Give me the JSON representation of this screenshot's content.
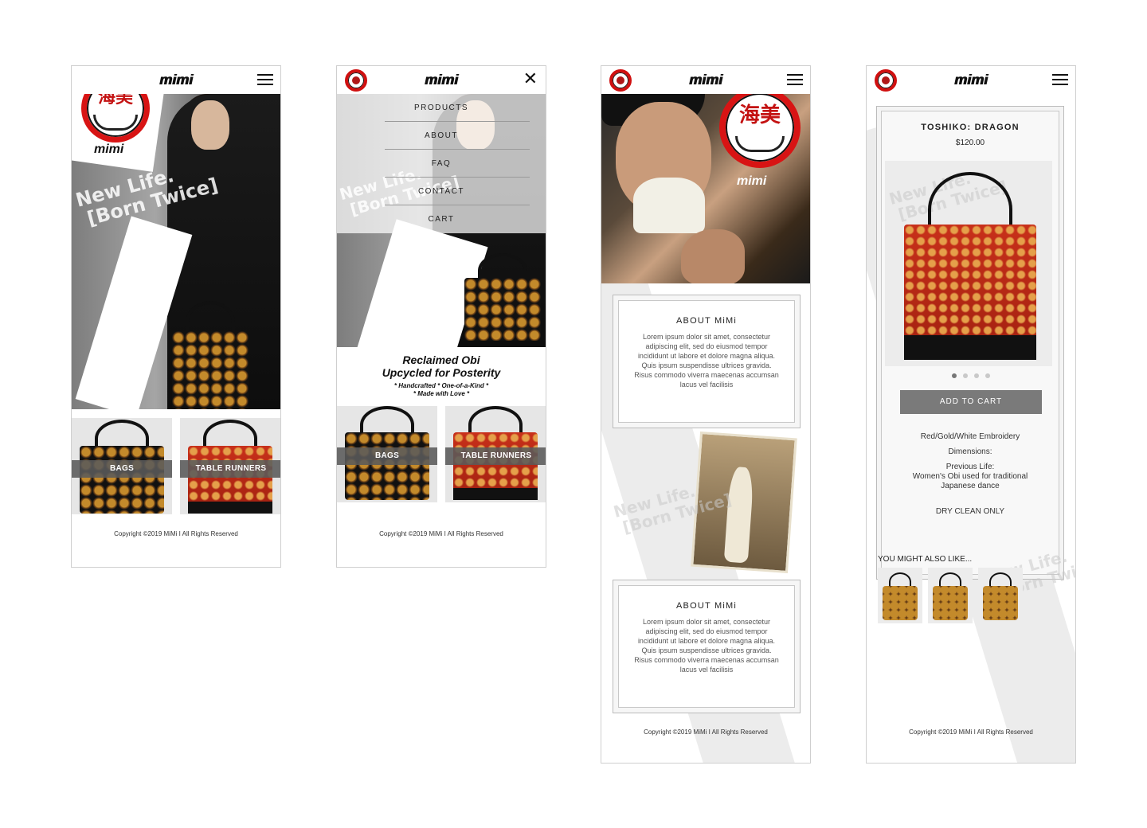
{
  "brand": {
    "wordmark": "mimi",
    "logo_kanji": "海美",
    "logo_word": "mimi"
  },
  "hero": {
    "tagline_line1": "New Life.",
    "tagline_line2": "[Born Twice]"
  },
  "categories": [
    {
      "label": "BAGS"
    },
    {
      "label": "TABLE RUNNERS"
    }
  ],
  "menu": {
    "items": [
      "PRODUCTS",
      "ABOUT",
      "FAQ",
      "CONTACT",
      "CART"
    ]
  },
  "promo": {
    "headline_line1": "Reclaimed Obi",
    "headline_line2": "Upcycled for Posterity",
    "sub_line1": "* Handcrafted * One-of-a-Kind *",
    "sub_line2": "* Made with Love *"
  },
  "about": {
    "title": "ABOUT MiMi",
    "body": "Lorem ipsum dolor sit amet, consectetur adipiscing elit, sed do eiusmod tempor incididunt ut labore et dolore magna aliqua. Quis ipsum suspendisse ultrices gravida. Risus commodo viverra maecenas accumsan lacus vel facilisis"
  },
  "product": {
    "name": "TOSHIKO: DRAGON",
    "price": "$120.00",
    "add_to_cart": "ADD TO CART",
    "spec_embroidery": "Red/Gold/White Embroidery",
    "spec_dimensions": "Dimensions:",
    "spec_previous_1": "Previous Life:",
    "spec_previous_2": "Women's Obi used for traditional",
    "spec_previous_3": "Japanese dance",
    "spec_care": "DRY CLEAN ONLY",
    "carousel_active": 1,
    "carousel_count": 4
  },
  "recommendations": {
    "title": "YOU MIGHT ALSO LIKE..."
  },
  "footer": {
    "copyright": "Copyright ©2019 MiMi I All Rights Reserved"
  },
  "colors": {
    "brand_red": "#d81414",
    "band_gray": "#5a5a5a",
    "button_gray": "#7a7a7a"
  },
  "icons": [
    "hamburger-menu-icon",
    "close-icon",
    "mimi-logo-icon"
  ]
}
